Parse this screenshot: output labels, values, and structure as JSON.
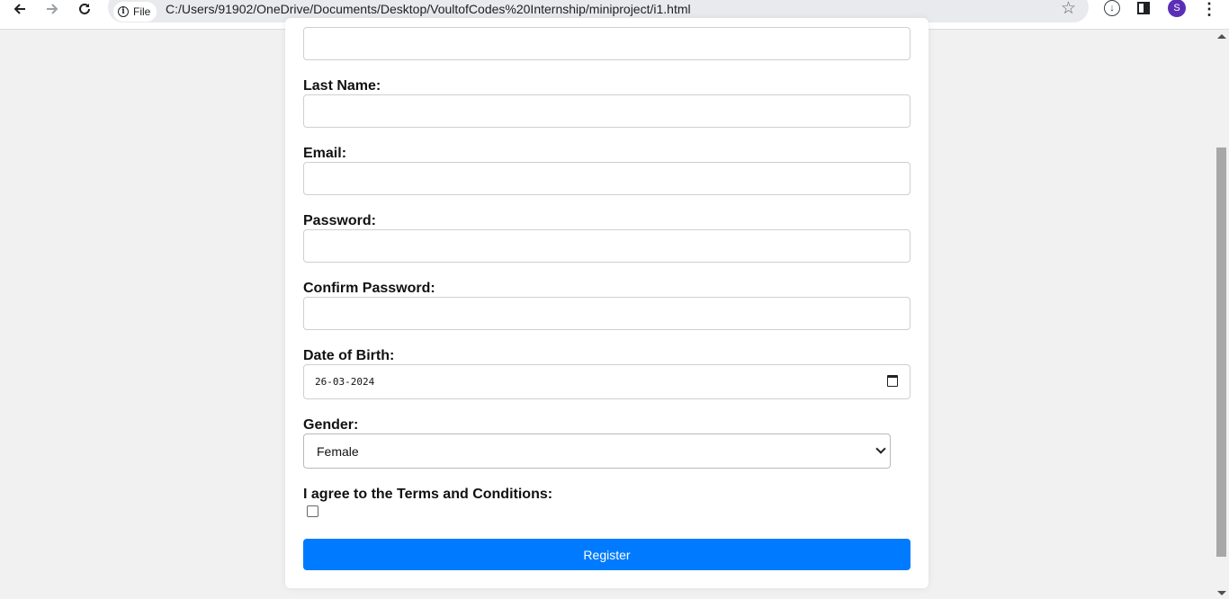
{
  "browser": {
    "site_chip_label": "File",
    "url": "C:/Users/91902/OneDrive/Documents/Desktop/VoultofCodes%20Internship/miniproject/i1.html",
    "profile_initial": "S",
    "profile_color": "#5b2fb5"
  },
  "form": {
    "first_name": {
      "value": ""
    },
    "last_name": {
      "label": "Last Name:",
      "value": ""
    },
    "email": {
      "label": "Email:",
      "value": ""
    },
    "password": {
      "label": "Password:",
      "value": ""
    },
    "confirm_password": {
      "label": "Confirm Password:",
      "value": ""
    },
    "dob": {
      "label": "Date of Birth:",
      "value": "26-03-2024"
    },
    "gender": {
      "label": "Gender:",
      "selected": "Female"
    },
    "terms": {
      "label": "I agree to the Terms and Conditions:",
      "checked": false
    },
    "submit_label": "Register",
    "accent_color": "#007bff"
  }
}
